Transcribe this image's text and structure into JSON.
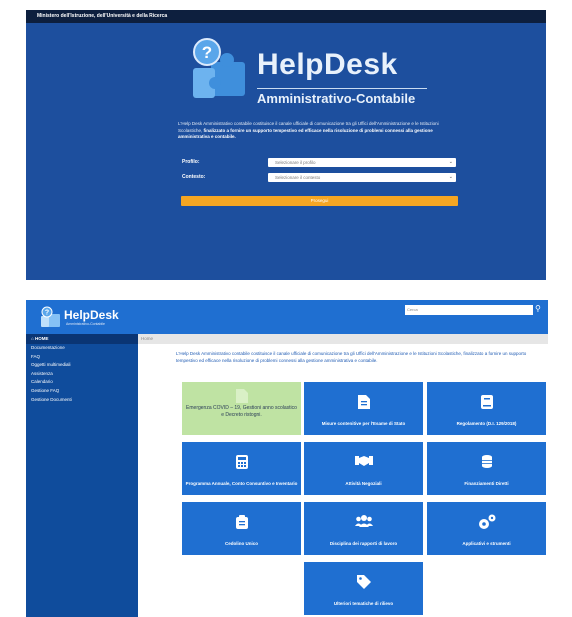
{
  "login": {
    "topbar_title": "Ministero dell'Istruzione, dell'Università e della Ricerca",
    "logo_title": "HelpDesk",
    "logo_subtitle": "Amministrativo-Contabile",
    "desc_plain": "L'Help Desk Amministrativo contabile costituisce il canale ufficiale di comunicazione tra gli Uffici dell'Amministrazione e le Istituzioni Scolastiche, ",
    "desc_bold": "finalizzato a fornire un supporto tempestivo ed efficace nella risoluzione di problemi connessi alla gestione amministrativa e contabile.",
    "profile_label": "Profilo:",
    "profile_placeholder": "Selezionare il profilo",
    "context_label": "Contesto:",
    "context_placeholder": "Selezionare il contesto",
    "proceed_label": "Prosegui"
  },
  "home": {
    "logo_title": "HelpDesk",
    "logo_subtitle": "Amministrativo-Contabile",
    "search_placeholder": "Cerca",
    "breadcrumb": "Home",
    "sidebar": [
      {
        "label": "HOME"
      },
      {
        "label": "Documentazione"
      },
      {
        "label": "FAQ"
      },
      {
        "label": "Oggetti multimediali"
      },
      {
        "label": "Assistenza"
      },
      {
        "label": "Calendario"
      },
      {
        "label": "Gestione FAQ"
      },
      {
        "label": "Gestione Documenti"
      }
    ],
    "intro": "L'Help Desk Amministrativo contabile costituisce il canale ufficiale di comunicazione tra gli Uffici dell'Amministrazione e le Istituzioni Scolastiche, finalizzato a fornire un supporto tempestivo ed efficace nella risoluzione di problemi connessi alla gestione amministrativa e contabile.",
    "tiles": [
      {
        "label": "Emergenza COVID – 19, Gestioni anno scolastico e Decreto ristogni.",
        "icon": "document-icon"
      },
      {
        "label": "Misure contenitive per l'Esame di Stato",
        "icon": "document-icon"
      },
      {
        "label": "Regolamento (D.I. 129/2018)",
        "icon": "book-icon"
      },
      {
        "label": "Programma Annuale, Conto Consuntivo e Inventario",
        "icon": "calculator-icon"
      },
      {
        "label": "Attività Negoziali",
        "icon": "handshake-icon"
      },
      {
        "label": "Finanziamenti Diretti",
        "icon": "coins-icon"
      },
      {
        "label": "Cedolino Unico",
        "icon": "payslip-icon"
      },
      {
        "label": "Disciplina dei rapporti di lavoro",
        "icon": "users-icon"
      },
      {
        "label": "Applicativi e strumenti",
        "icon": "gears-icon"
      },
      {
        "label": "Ulteriori tematiche di rilievo",
        "icon": "tag-icon"
      }
    ]
  },
  "colors": {
    "login_bg": "#1d4f9e",
    "topbar": "#0d1f3e",
    "header_blue": "#1f6fd1",
    "sidebar_blue": "#0f4c9c",
    "accent_orange": "#f5a623",
    "covid_green": "#bfe3a3"
  }
}
